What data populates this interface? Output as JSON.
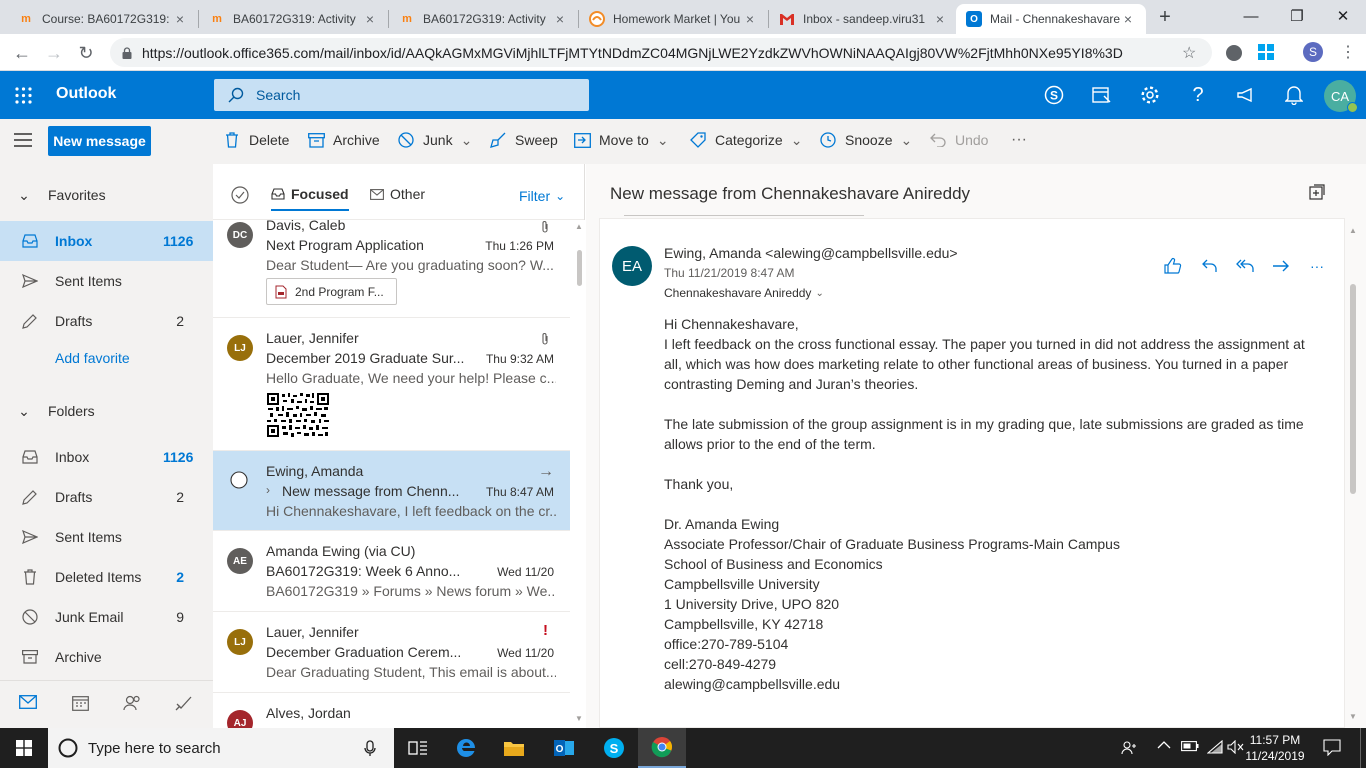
{
  "browser": {
    "tabs": [
      {
        "title": "Course: BA60172G319: ",
        "favicon": "moodle-icon",
        "active": false
      },
      {
        "title": "BA60172G319: Activity ",
        "favicon": "moodle-icon",
        "active": false
      },
      {
        "title": "BA60172G319: Activity ",
        "favicon": "moodle-icon",
        "active": false
      },
      {
        "title": "Homework Market | You",
        "favicon": "homework-market-icon",
        "active": false
      },
      {
        "title": "Inbox - sandeep.viru31",
        "favicon": "gmail-icon",
        "active": false
      },
      {
        "title": "Mail - Chennakeshavare",
        "favicon": "outlook-icon",
        "active": true
      }
    ],
    "new_tab": "+",
    "url": "https://outlook.office365.com/mail/inbox/id/AAQkAGMxMGViMjhlLTFjMTYtNDdmZC04MGNjLWE2YzdkZWVhOWNiNAAQAIgj80VW%2FjtMhh0NXe95YI8%3D",
    "profile_initial": "S"
  },
  "outlook": {
    "brand": "Outlook",
    "search_placeholder": "Search",
    "user_initials": "CA",
    "accent": "#0078d4"
  },
  "commands": {
    "new_message": "New message",
    "delete": "Delete",
    "archive": "Archive",
    "junk": "Junk",
    "sweep": "Sweep",
    "move_to": "Move to",
    "categorize": "Categorize",
    "snooze": "Snooze",
    "undo": "Undo",
    "more": "···"
  },
  "nav": {
    "favorites_label": "Favorites",
    "favorites": [
      {
        "label": "Inbox",
        "count": "1126",
        "selected": true,
        "icon": "inbox-icon"
      },
      {
        "label": "Sent Items",
        "count": "",
        "icon": "send-icon"
      },
      {
        "label": "Drafts",
        "count": "2",
        "icon": "pencil-icon"
      }
    ],
    "add_favorite": "Add favorite",
    "folders_label": "Folders",
    "folders": [
      {
        "label": "Inbox",
        "count": "1126",
        "icon": "inbox-icon"
      },
      {
        "label": "Drafts",
        "count": "2",
        "icon": "pencil-icon"
      },
      {
        "label": "Sent Items",
        "count": "",
        "icon": "send-icon"
      },
      {
        "label": "Deleted Items",
        "count": "2",
        "icon": "trash-icon"
      },
      {
        "label": "Junk Email",
        "count": "9",
        "icon": "block-icon"
      },
      {
        "label": "Archive",
        "count": "",
        "icon": "archive-icon"
      }
    ]
  },
  "list": {
    "focused": "Focused",
    "other": "Other",
    "filter": "Filter",
    "messages": [
      {
        "initials": "DC",
        "color": "#605e5c",
        "from": "Davis, Caleb",
        "subject": "Next Program Application",
        "time": "Thu 1:26 PM",
        "preview": "Dear Student— Are you graduating soon? W...",
        "attachment": "2nd Program F...",
        "has_clip": true
      },
      {
        "initials": "LJ",
        "color": "#986f0b",
        "from": "Lauer, Jennifer",
        "subject": "December 2019 Graduate Sur...",
        "time": "Thu 9:32 AM",
        "preview": "Hello Graduate, We need your help! Please c...",
        "has_clip": true
      },
      {
        "initials": "",
        "color": "",
        "from": "Ewing, Amanda",
        "subject": "New message from Chenn...",
        "time": "Thu 8:47 AM",
        "preview": "Hi Chennakeshavare, I left feedback on the cr...",
        "selected": true
      },
      {
        "initials": "AE",
        "color": "#605e5c",
        "from": "Amanda Ewing (via CU)",
        "subject": "BA60172G319: Week 6 Anno...",
        "time": "Wed 11/20",
        "preview": "BA60172G319 » Forums » News forum » We..."
      },
      {
        "initials": "LJ",
        "color": "#986f0b",
        "from": "Lauer, Jennifer",
        "subject": "December Graduation Cerem...",
        "time": "Wed 11/20",
        "preview": "Dear Graduating Student, This email is about...",
        "important": "!"
      },
      {
        "initials": "AJ",
        "color": "#a4262c",
        "from": "Alves, Jordan",
        "subject": "",
        "time": "",
        "preview": ""
      }
    ]
  },
  "reading": {
    "title": "New message from Chennakeshavare Anireddy",
    "avatar": "EA",
    "from": "Ewing, Amanda <alewing@campbellsville.edu>",
    "date": "Thu 11/21/2019 8:47 AM",
    "to": "Chennakeshavare Anireddy",
    "body": {
      "greeting": "Hi Chennakeshavare,",
      "para1": "I left feedback on the cross functional essay. The paper you turned in did not address the assignment at all, which was how does marketing relate to other functional areas of business. You turned in a paper contrasting Deming and Juran’s theories.",
      "para2": "The late submission of the group assignment is in my grading que, late submissions are graded as time allows prior to the end of the term.",
      "thanks": "Thank you,",
      "sig": [
        "Dr. Amanda Ewing",
        "Associate Professor/Chair of Graduate Business Programs-Main Campus",
        "School of Business and Economics",
        "Campbellsville University",
        "1 University Drive, UPO 820",
        "Campbellsville, KY 42718",
        "office:270-789-5104",
        "cell:270-849-4279",
        "alewing@campbellsville.edu"
      ]
    }
  },
  "taskbar": {
    "search_placeholder": "Type here to search",
    "time": "11:57 PM",
    "date": "11/24/2019"
  }
}
